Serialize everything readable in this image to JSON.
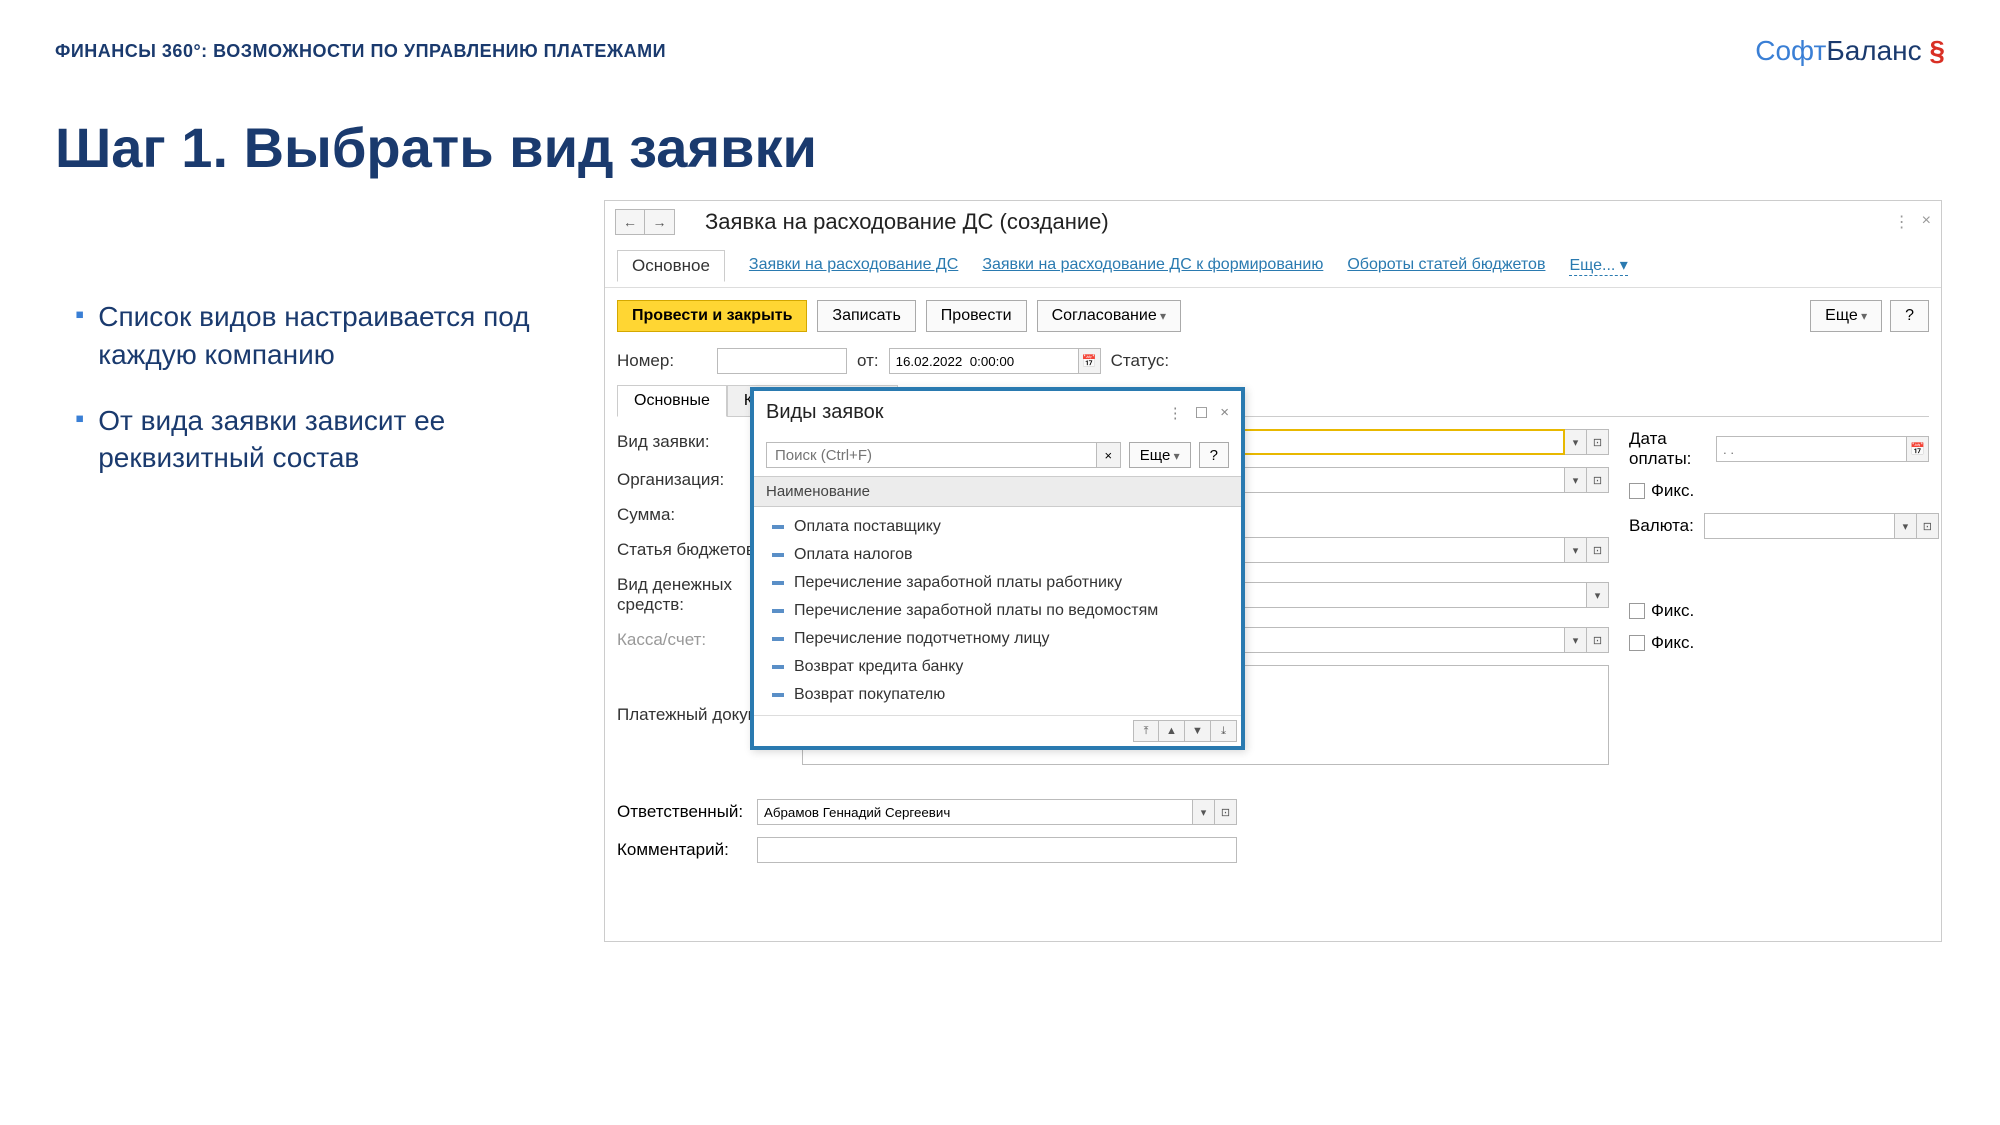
{
  "slide": {
    "header": "ФИНАНСЫ 360°: ВОЗМОЖНОСТИ ПО УПРАВЛЕНИЮ ПЛАТЕЖАМИ",
    "logo_soft": "Софт",
    "logo_balance": "Баланс",
    "logo_symbol": "§",
    "title": "Шаг 1. Выбрать вид заявки",
    "bullets": [
      "Список видов настраивается под каждую компанию",
      "От вида заявки зависит ее реквизитный состав"
    ]
  },
  "window": {
    "title": "Заявка на расходование ДС (создание)",
    "nav_back": "←",
    "nav_fwd": "→",
    "menu_icon": "⋮",
    "close_icon": "×",
    "tabs": {
      "main": "Основное",
      "link1": "Заявки на расходование ДС",
      "link2": "Заявки на расходование ДС к формированию",
      "link3": "Обороты статей бюджетов",
      "more": "Еще..."
    },
    "toolbar": {
      "post_close": "Провести и закрыть",
      "save": "Записать",
      "post": "Провести",
      "approval": "Согласование",
      "more": "Еще",
      "help": "?"
    },
    "header_fields": {
      "number_label": "Номер:",
      "from_label": "от:",
      "date_value": "16.02.2022  0:00:00",
      "status_label": "Статус:"
    },
    "inner_tabs": {
      "main": "Основные",
      "limits": "Контроль лимитов"
    },
    "fields": {
      "request_type": "Вид заявки:",
      "org": "Организация:",
      "sum": "Сумма:",
      "budget_item": "Статья бюджетов:",
      "money_type": "Вид денежных средств:",
      "cash_account": "Касса/счет:",
      "payment_doc": "Платежный документ:",
      "payment_date": "Дата оплаты:",
      "currency": "Валюта:",
      "fixed": "Фикс.",
      "responsible": "Ответственный:",
      "responsible_value": "Абрамов Геннадий Сергеевич",
      "comment": "Комментарий:",
      "date_placeholder": ". ."
    }
  },
  "popup": {
    "title": "Виды заявок",
    "search_placeholder": "Поиск (Ctrl+F)",
    "clear": "×",
    "more": "Еще",
    "help": "?",
    "column": "Наименование",
    "items": [
      "Оплата поставщику",
      "Оплата налогов",
      "Перечисление заработной платы работнику",
      "Перечисление заработной платы по ведомостям",
      "Перечисление подотчетному лицу",
      "Возврат кредита банку",
      "Возврат покупателю"
    ],
    "icons": {
      "menu": "⋮",
      "max": "☐",
      "close": "×"
    },
    "nav": {
      "first": "⤒",
      "up": "▲",
      "down": "▼",
      "last": "⤓"
    }
  }
}
